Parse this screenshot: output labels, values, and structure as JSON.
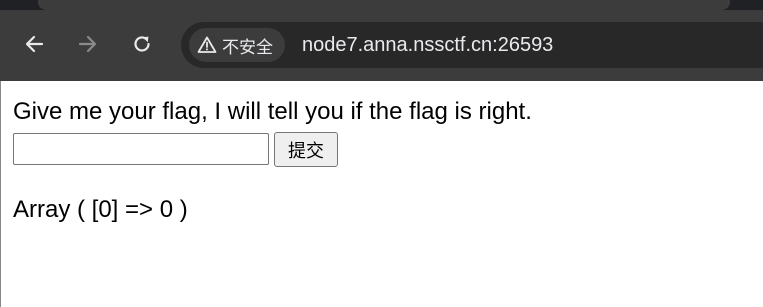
{
  "browser": {
    "security_label": "不安全",
    "url": "node7.anna.nssctf.cn:26593",
    "icons": {
      "back": "back-arrow-icon",
      "forward": "forward-arrow-icon",
      "reload": "reload-icon",
      "warning": "warning-triangle-icon"
    }
  },
  "page": {
    "prompt": "Give me your flag, I will tell you if the flag is right.",
    "form": {
      "input_value": "",
      "submit_label": "提交"
    },
    "result": "Array ( [0] => 0 )"
  }
}
